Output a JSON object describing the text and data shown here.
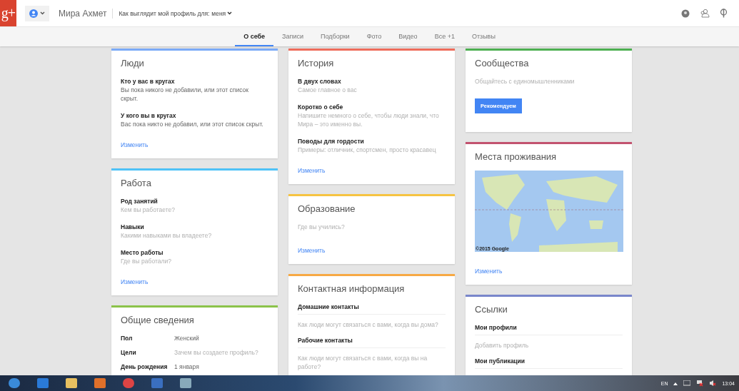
{
  "header": {
    "logo": "g+",
    "user_name": "Мира Ахмет",
    "view_as_label": "Как выглядит мой профиль для:",
    "view_as_value": "меня"
  },
  "tabs": [
    {
      "label": "О себе",
      "selected": true
    },
    {
      "label": "Записи",
      "selected": false
    },
    {
      "label": "Подборки",
      "selected": false
    },
    {
      "label": "Фото",
      "selected": false
    },
    {
      "label": "Видео",
      "selected": false
    },
    {
      "label": "Все +1",
      "selected": false
    },
    {
      "label": "Отзывы",
      "selected": false
    }
  ],
  "columns": [
    {
      "cards": [
        {
          "title": "Люди",
          "color": "#7baaf7",
          "items": [
            {
              "kind": "field",
              "label": "Кто у вас в кругах",
              "value": "Вы пока никого не добавили, или этот список скрыт.",
              "empty": false
            },
            {
              "kind": "field",
              "label": "У кого вы в кругах",
              "value": "Вас пока никто не добавил, или этот список скрыт.",
              "empty": false
            },
            {
              "kind": "link",
              "label": "Изменить"
            }
          ]
        },
        {
          "title": "Работа",
          "color": "#4fc3f7",
          "items": [
            {
              "kind": "field",
              "label": "Род занятий",
              "value": "Кем вы работаете?",
              "empty": true
            },
            {
              "kind": "field",
              "label": "Навыки",
              "value": "Какими навыками вы владеете?",
              "empty": true
            },
            {
              "kind": "field",
              "label": "Место работы",
              "value": "Где вы работали?",
              "empty": true
            },
            {
              "kind": "link",
              "label": "Изменить"
            }
          ]
        },
        {
          "title": "Общие сведения",
          "color": "#8bc34a",
          "items": [
            {
              "kind": "facts",
              "rows": [
                {
                  "label": "Пол",
                  "value": "Женский",
                  "empty": false
                },
                {
                  "label": "Цели",
                  "value": "Зачем вы создаете профиль?",
                  "empty": true
                },
                {
                  "label": "День рождения",
                  "value": "1 января",
                  "empty": false
                }
              ]
            }
          ]
        }
      ]
    },
    {
      "cards": [
        {
          "title": "История",
          "color": "#ef6c5b",
          "items": [
            {
              "kind": "field",
              "label": "В двух словах",
              "value": "Самое главное о вас",
              "empty": true
            },
            {
              "kind": "field",
              "label": "Коротко о себе",
              "value": "Напишите немного о себе, чтобы люди знали, что Мира – это именно вы.",
              "empty": true
            },
            {
              "kind": "field",
              "label": "Поводы для гордости",
              "value": "Примеры: отличник, спортсмен, просто красавец",
              "empty": true
            },
            {
              "kind": "link",
              "label": "Изменить"
            }
          ]
        },
        {
          "title": "Образование",
          "color": "#f6c342",
          "items": [
            {
              "kind": "text",
              "value": "Где вы учились?",
              "empty": true
            },
            {
              "kind": "link",
              "label": "Изменить"
            }
          ]
        },
        {
          "title": "Контактная информация",
          "color": "#f7a944",
          "items": [
            {
              "kind": "contact",
              "label": "Домашние контакты",
              "value": "Как люди могут связаться с вами, когда вы дома?",
              "empty": true
            },
            {
              "kind": "contact",
              "label": "Рабочие контакты",
              "value": "Как люди могут связаться с вами, когда вы на работе?",
              "empty": true
            }
          ]
        }
      ]
    },
    {
      "cards": [
        {
          "title": "Сообщества",
          "color": "#4caf50",
          "items": [
            {
              "kind": "text",
              "value": "Общайтесь с единомышленниками",
              "empty": true
            },
            {
              "kind": "button",
              "label": "Рекомендуем"
            }
          ]
        },
        {
          "title": "Места проживания",
          "color": "#c2536f",
          "items": [
            {
              "kind": "map",
              "attribution": "©2015 Google"
            },
            {
              "kind": "link",
              "label": "Изменить"
            }
          ]
        },
        {
          "title": "Ссылки",
          "color": "#7986cb",
          "items": [
            {
              "kind": "contact",
              "label": "Мои профили",
              "value": "Добавить профиль",
              "empty": true
            },
            {
              "kind": "contact",
              "label": "Мои публикации"
            }
          ]
        }
      ]
    }
  ],
  "taskbar": {
    "language": "EN",
    "time": "13:04"
  }
}
